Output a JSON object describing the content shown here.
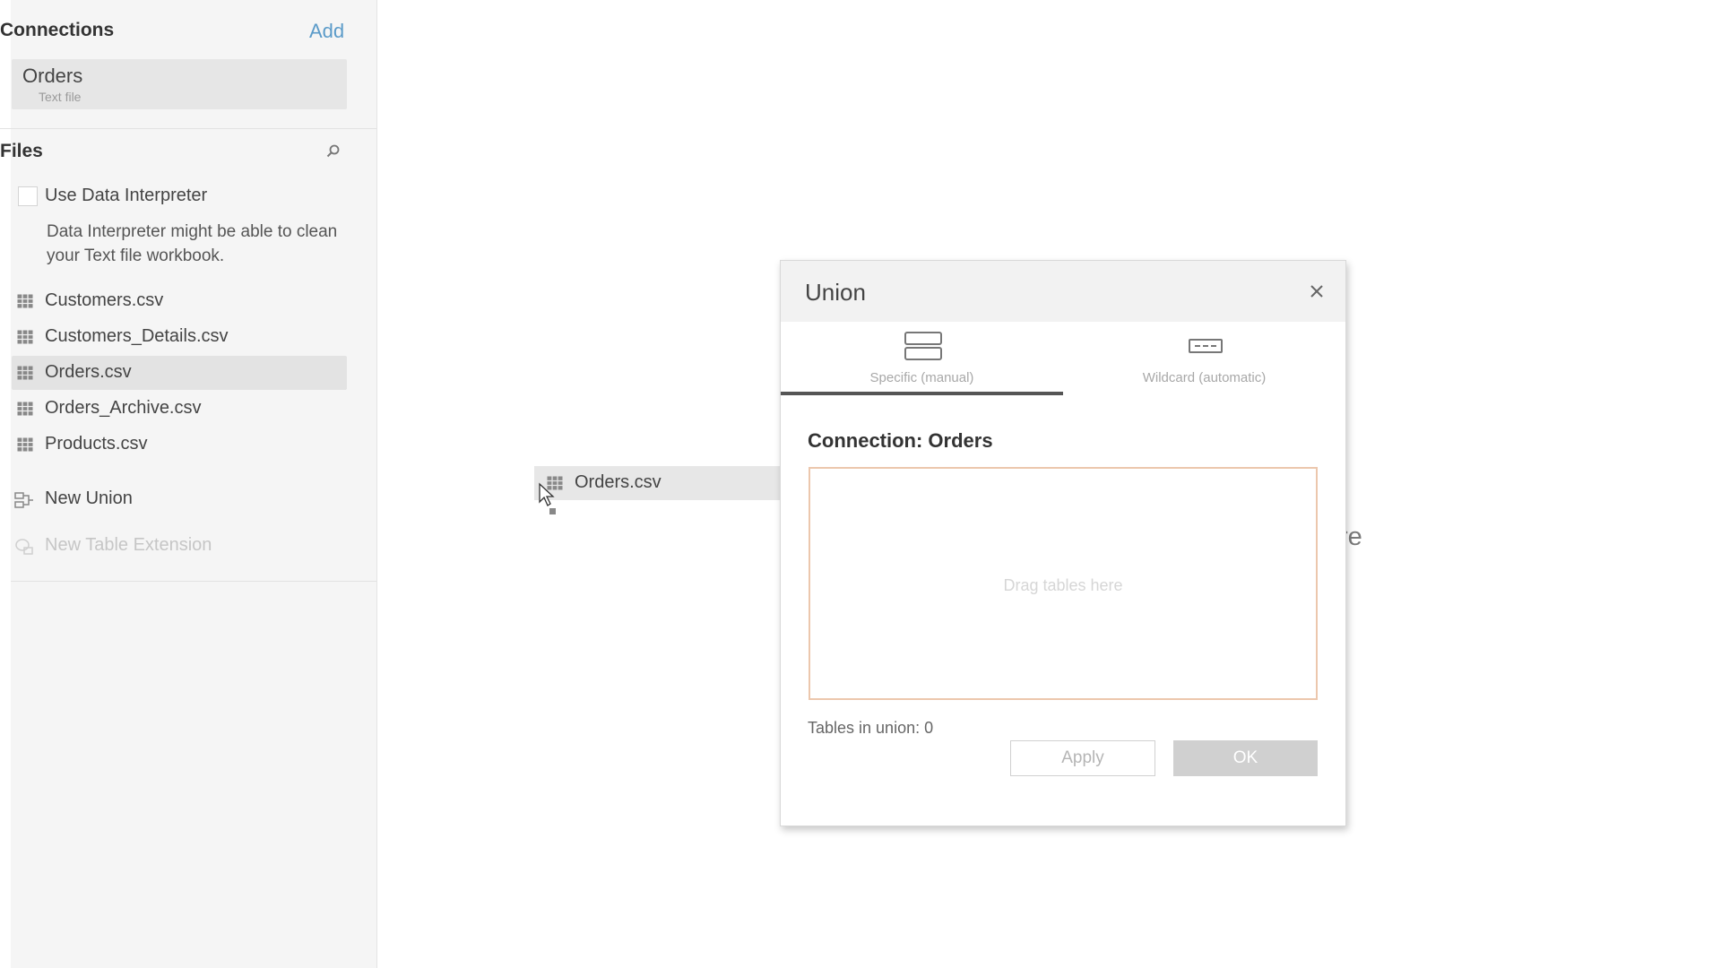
{
  "connections": {
    "title": "Connections",
    "add_label": "Add",
    "items": [
      {
        "name": "Orders",
        "type": "Text file"
      }
    ]
  },
  "files": {
    "title": "Files",
    "search_icon": "search-icon",
    "data_interpreter": {
      "label": "Use Data Interpreter",
      "checked": false,
      "description": "Data Interpreter might be able to clean your Text file workbook."
    },
    "items": [
      {
        "label": "Customers.csv",
        "icon": "table-icon",
        "selected": false
      },
      {
        "label": "Customers_Details.csv",
        "icon": "table-icon",
        "selected": false
      },
      {
        "label": "Orders.csv",
        "icon": "table-icon",
        "selected": true
      },
      {
        "label": "Orders_Archive.csv",
        "icon": "table-icon",
        "selected": false
      },
      {
        "label": "Products.csv",
        "icon": "table-icon",
        "selected": false
      }
    ],
    "new_union": "New Union",
    "new_table_extension": "New Table Extension"
  },
  "canvas": {
    "partial_text": "re"
  },
  "drag": {
    "label": "Orders.csv"
  },
  "dialog": {
    "title": "Union",
    "tabs": [
      {
        "label": "Specific (manual)",
        "active": true
      },
      {
        "label": "Wildcard (automatic)",
        "active": false
      }
    ],
    "connection_label": "Connection: Orders",
    "drop_hint": "Drag tables here",
    "tables_count": "Tables in union: 0",
    "apply_label": "Apply",
    "ok_label": "OK"
  },
  "colors": {
    "accent_link": "#5b9bc9",
    "drop_border": "#ecc7ad",
    "selected_bg": "#e3e3e3"
  }
}
